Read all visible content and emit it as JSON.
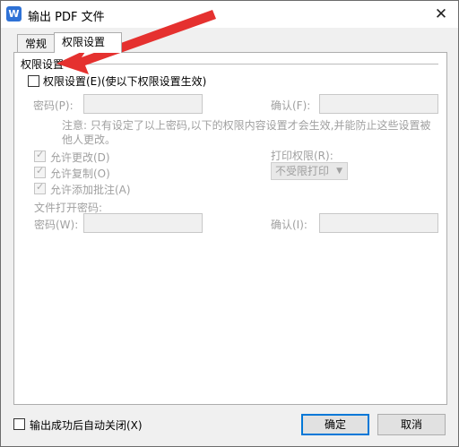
{
  "window": {
    "title": "输出 PDF 文件",
    "app_icon_letter": "W",
    "close_glyph": "✕"
  },
  "tabs": [
    {
      "label": "常规",
      "active": false
    },
    {
      "label": "权限设置",
      "active": true
    }
  ],
  "permissions": {
    "group_title": "权限设置",
    "enable_label": "权限设置(E)(使以下权限设置生效)",
    "password_label": "密码(P):",
    "confirm_label": "确认(F):",
    "note": "注意: 只有设定了以上密码,以下的权限内容设置才会生效,并能防止这些设置被他人更改。",
    "allow_edit": "允许更改(D)",
    "allow_copy": "允许复制(O)",
    "allow_annot": "允许添加批注(A)",
    "print_label": "打印权限(R):",
    "print_value": "不受限打印",
    "open_password_title": "文件打开密码:",
    "open_password_label": "密码(W):",
    "open_confirm_label": "确认(I):"
  },
  "footer": {
    "auto_close_label": "输出成功后自动关闭(X)",
    "ok_label": "确定",
    "cancel_label": "取消"
  },
  "colors": {
    "accent": "#0078d7",
    "arrow": "#e5312f",
    "disabled_text": "#a0a0a0"
  }
}
